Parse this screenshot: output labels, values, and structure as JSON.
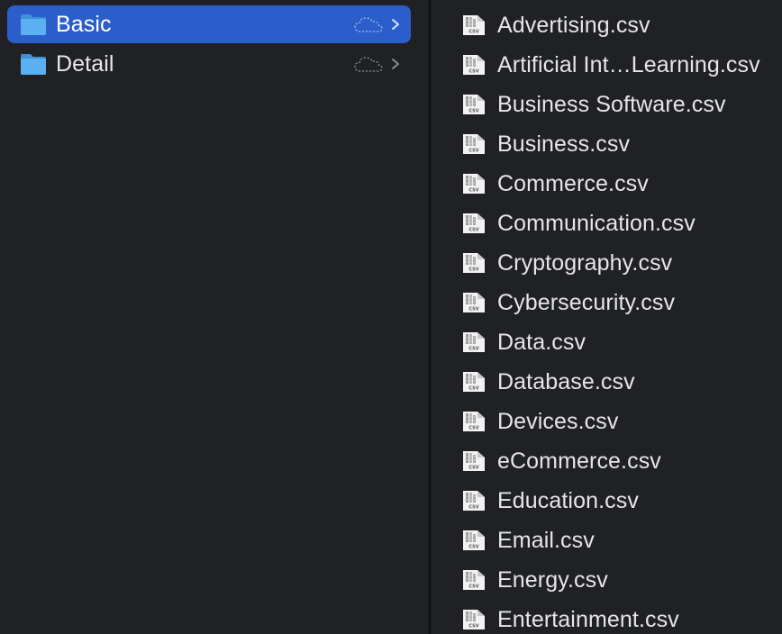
{
  "sidebar": {
    "folders": [
      {
        "label": "Basic",
        "selected": true,
        "icon": "folder-icon",
        "status_icon": "cloud-icon"
      },
      {
        "label": "Detail",
        "selected": false,
        "icon": "folder-icon",
        "status_icon": "cloud-icon"
      }
    ]
  },
  "files": {
    "icon": "csv-file-icon",
    "icon_text": "CSV",
    "items": [
      {
        "label": "Advertising.csv"
      },
      {
        "label": "Artificial Int…Learning.csv"
      },
      {
        "label": "Business Software.csv"
      },
      {
        "label": "Business.csv"
      },
      {
        "label": "Commerce.csv"
      },
      {
        "label": "Communication.csv"
      },
      {
        "label": "Cryptography.csv"
      },
      {
        "label": "Cybersecurity.csv"
      },
      {
        "label": "Data.csv"
      },
      {
        "label": "Database.csv"
      },
      {
        "label": "Devices.csv"
      },
      {
        "label": "eCommerce.csv"
      },
      {
        "label": "Education.csv"
      },
      {
        "label": "Email.csv"
      },
      {
        "label": "Energy.csv"
      },
      {
        "label": "Entertainment.csv"
      }
    ]
  },
  "colors": {
    "background": "#1f2124",
    "selection": "#2b5ecb",
    "folder": "#4aa3e8",
    "text": "#e6e6e8"
  }
}
